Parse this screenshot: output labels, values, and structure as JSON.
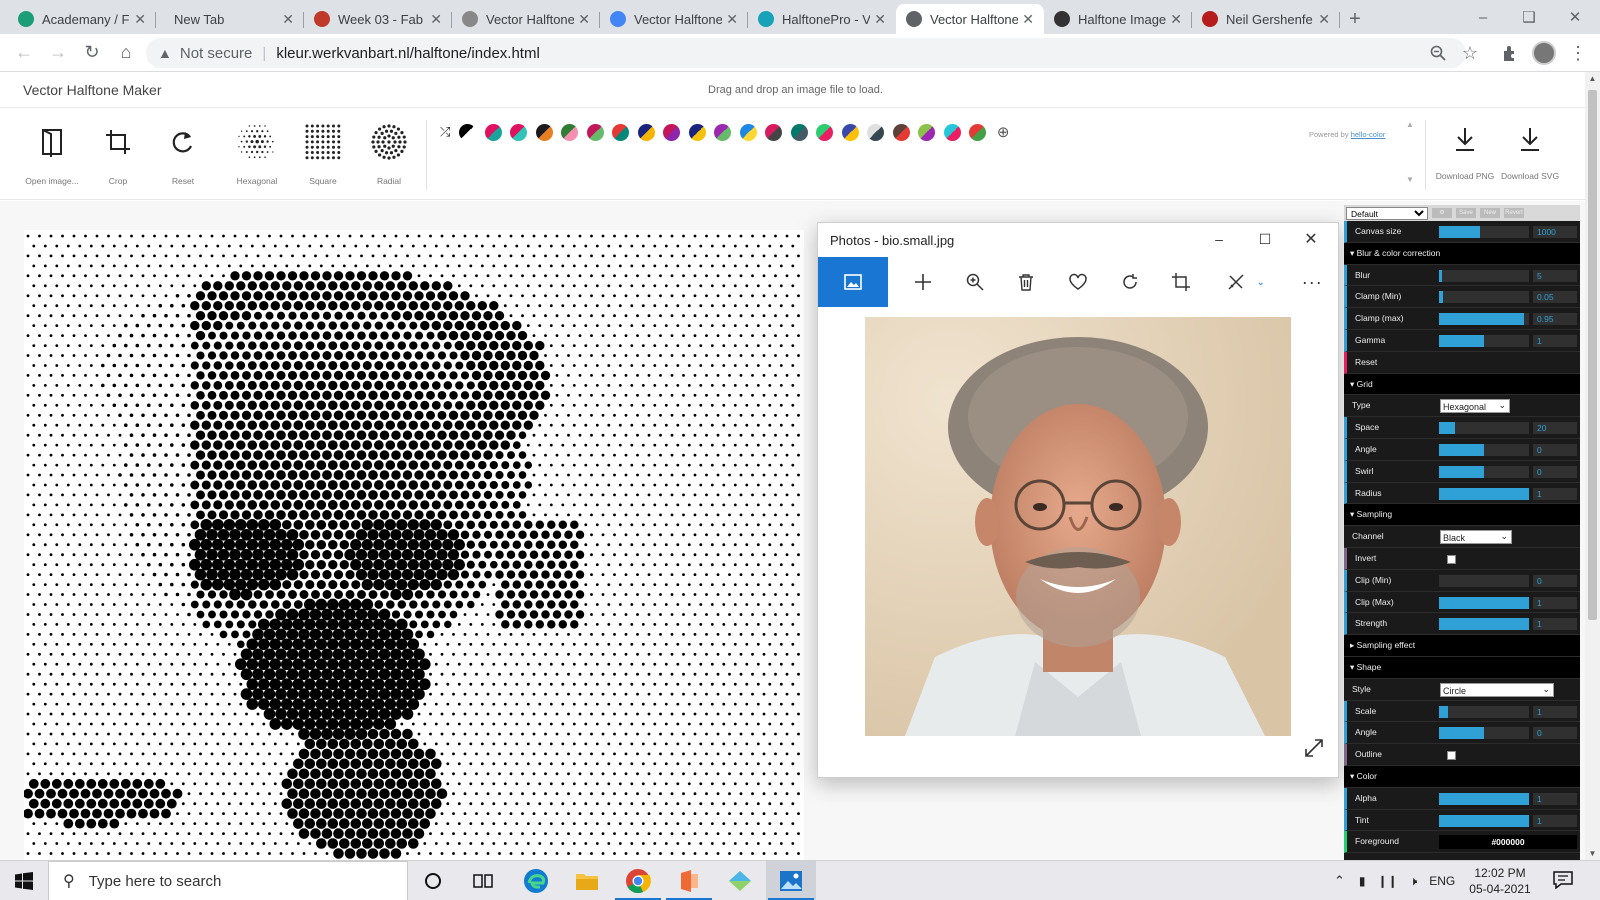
{
  "browser": {
    "tabs": [
      {
        "label": "Academany / F",
        "favicon_color": "#1b9e77"
      },
      {
        "label": "New Tab",
        "favicon_color": ""
      },
      {
        "label": "Week 03 - Fab",
        "favicon_color": "#c0392b"
      },
      {
        "label": "Vector Halftone",
        "favicon_color": "#888888"
      },
      {
        "label": "Vector Halftone",
        "favicon_color": "#4285f4"
      },
      {
        "label": "HalftonePro - V",
        "favicon_color": "#17a2b8"
      },
      {
        "label": "Vector Halftone",
        "favicon_color": "#5f6368"
      },
      {
        "label": "Halftone Image",
        "favicon_color": "#333333"
      },
      {
        "label": "Neil Gershenfe",
        "favicon_color": "#b71c1c"
      }
    ],
    "active_tab_index": 6,
    "security_text": "Not secure",
    "url": "kleur.werkvanbart.nl/halftone/index.html"
  },
  "app": {
    "title": "Vector Halftone Maker",
    "hint": "Drag and drop an image file to load.",
    "tools": [
      {
        "icon": "open-image-icon",
        "label": "Open image..."
      },
      {
        "icon": "crop-icon",
        "label": "Crop"
      },
      {
        "icon": "reset-icon",
        "label": "Reset"
      },
      {
        "icon": "hexagonal-grid-icon",
        "label": "Hexagonal"
      },
      {
        "icon": "square-grid-icon",
        "label": "Square"
      },
      {
        "icon": "radial-grid-icon",
        "label": "Radial"
      }
    ],
    "palettes": [
      [
        "#000000",
        "#ffffff"
      ],
      [
        "#e0115f",
        "#1aa39b"
      ],
      [
        "#e0115f",
        "#2ec4b6"
      ],
      [
        "#1b1b1b",
        "#e67e22"
      ],
      [
        "#2e7d32",
        "#f48fb1"
      ],
      [
        "#c2185b",
        "#66bb6a"
      ],
      [
        "#e53935",
        "#00897b"
      ],
      [
        "#1a237e",
        "#f7b500"
      ],
      [
        "#c2185b",
        "#8e24aa"
      ],
      [
        "#1a237e",
        "#f4c20d"
      ],
      [
        "#9c27b0",
        "#66bb6a"
      ],
      [
        "#1e88e5",
        "#fdd835"
      ],
      [
        "#d81b60",
        "#444444"
      ],
      [
        "#00796b",
        "#455a64"
      ],
      [
        "#2ecc71",
        "#e91e63"
      ],
      [
        "#3949ab",
        "#ffc107"
      ],
      [
        "#e0e0e0",
        "#37474f"
      ],
      [
        "#5d4037",
        "#e53935"
      ],
      [
        "#8bc34a",
        "#9c27b0"
      ],
      [
        "#26c6da",
        "#e91e63"
      ],
      [
        "#e53935",
        "#43a047"
      ]
    ],
    "powered_by_prefix": "Powered by",
    "powered_by_link": "hello-color",
    "downloads": [
      {
        "icon": "download-icon",
        "label": "Download PNG"
      },
      {
        "icon": "download-icon",
        "label": "Download SVG"
      }
    ]
  },
  "photos": {
    "title": "Photos - bio.small.jpg"
  },
  "gui": {
    "preset": "Default",
    "preset_buttons": [
      "Save",
      "New",
      "Revert"
    ],
    "rows": [
      {
        "kind": "num",
        "label": "Canvas size",
        "value": "1000",
        "fill": 0.45
      },
      {
        "kind": "fold",
        "label": "Blur & color correction",
        "state": "open"
      },
      {
        "kind": "num",
        "label": "Blur",
        "value": "5",
        "fill": 0.03
      },
      {
        "kind": "num",
        "label": "Clamp (Min)",
        "value": "0.05",
        "fill": 0.04
      },
      {
        "kind": "num",
        "label": "Clamp (max)",
        "value": "0.95",
        "fill": 0.94
      },
      {
        "kind": "num",
        "label": "Gamma",
        "value": "1",
        "fill": 0.5
      },
      {
        "kind": "fn",
        "label": "Reset"
      },
      {
        "kind": "fold",
        "label": "Grid",
        "state": "open"
      },
      {
        "kind": "sel",
        "label": "Type",
        "value": "Hexagonal",
        "width": 70
      },
      {
        "kind": "num",
        "label": "Space",
        "value": "20",
        "fill": 0.18
      },
      {
        "kind": "num",
        "label": "Angle",
        "value": "0",
        "fill": 0.5
      },
      {
        "kind": "num",
        "label": "Swirl",
        "value": "0",
        "fill": 0.5
      },
      {
        "kind": "num",
        "label": "Radius",
        "value": "1",
        "fill": 1.0
      },
      {
        "kind": "fold",
        "label": "Sampling",
        "state": "open"
      },
      {
        "kind": "sel",
        "label": "Channel",
        "value": "Black",
        "width": 72
      },
      {
        "kind": "chk",
        "label": "Invert"
      },
      {
        "kind": "num",
        "label": "Clip (Min)",
        "value": "0",
        "fill": 0.0
      },
      {
        "kind": "num",
        "label": "Clip (Max)",
        "value": "1",
        "fill": 1.0
      },
      {
        "kind": "num",
        "label": "Strength",
        "value": "1",
        "fill": 1.0
      },
      {
        "kind": "fold",
        "label": "Sampling effect",
        "state": "collapsed"
      },
      {
        "kind": "fold",
        "label": "Shape",
        "state": "open"
      },
      {
        "kind": "sel",
        "label": "Style",
        "value": "Circle",
        "width": 114
      },
      {
        "kind": "num",
        "label": "Scale",
        "value": "1",
        "fill": 0.1
      },
      {
        "kind": "num",
        "label": "Angle",
        "value": "0",
        "fill": 0.5
      },
      {
        "kind": "chk",
        "label": "Outline"
      },
      {
        "kind": "fold",
        "label": "Color",
        "state": "open"
      },
      {
        "kind": "num",
        "label": "Alpha",
        "value": "1",
        "fill": 1.0
      },
      {
        "kind": "num",
        "label": "Tint",
        "value": "1",
        "fill": 1.0
      },
      {
        "kind": "col",
        "label": "Foreground",
        "value": "#000000"
      }
    ]
  },
  "taskbar": {
    "search_placeholder": "Type here to search",
    "language": "ENG",
    "time": "12:02 PM",
    "date": "05-04-2021"
  },
  "colors": {
    "accent": "#1976d2",
    "gui_slider": "#2fa1d6"
  }
}
